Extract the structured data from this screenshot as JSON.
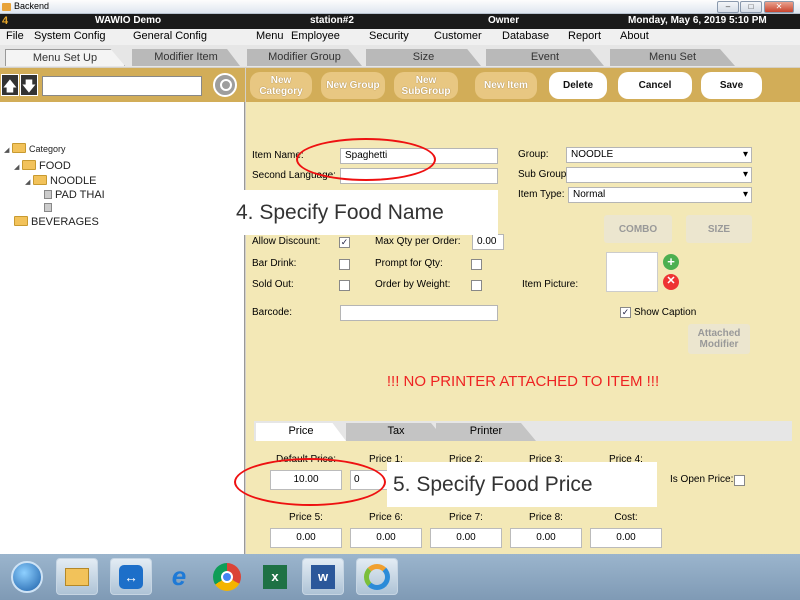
{
  "window": {
    "title": "Backend"
  },
  "appbar": {
    "logo": "4",
    "company": "WAWIO Demo",
    "station": "station#2",
    "user": "Owner",
    "datetime": "Monday, May 6, 2019 5:10 PM"
  },
  "menu": [
    "File",
    "System Config",
    "General Config",
    "Menu",
    "Employee",
    "Security",
    "Customer",
    "Database",
    "Report",
    "About"
  ],
  "tabs": [
    "Menu Set Up",
    "Modifier Item",
    "Modifier Group",
    "Size",
    "Event",
    "Menu Set"
  ],
  "toolbar": {
    "new_category": "New Category",
    "new_group": "New Group",
    "new_subgroup": "New SubGroup",
    "new_item": "New Item",
    "delete": "Delete",
    "cancel": "Cancel",
    "save": "Save"
  },
  "tree": {
    "root": "Category",
    "food": "FOOD",
    "noodle": "NOODLE",
    "pad_thai": "PAD THAI",
    "beverages": "BEVERAGES"
  },
  "form": {
    "item_name_label": "Item Name:",
    "item_name": "Spaghetti",
    "second_language_label": "Second Language:",
    "group_label": "Group:",
    "group_value": "NOODLE",
    "sub_group_label": "Sub Group:",
    "item_type_label": "Item Type:",
    "item_type_value": "Normal",
    "combo": "COMBO",
    "size": "SIZE",
    "allow_discount_label": "Allow Discount:",
    "max_qty_label": "Max Qty per Order:",
    "max_qty_value": "0.00",
    "bar_drink_label": "Bar Drink:",
    "prompt_qty_label": "Prompt for Qty:",
    "sold_out_label": "Sold Out:",
    "order_weight_label": "Order by Weight:",
    "item_picture_label": "Item Picture:",
    "barcode_label": "Barcode:",
    "show_caption_label": "Show Caption",
    "attached_modifier": "Attached Modifier",
    "warning": "!!! NO PRINTER ATTACHED TO ITEM !!!"
  },
  "bottom_tabs": [
    "Price",
    "Tax",
    "Printer"
  ],
  "prices": {
    "default_label": "Default Price:",
    "default_value": "10.00",
    "p1_label": "Price 1:",
    "p1_value": "0",
    "p2_label": "Price 2:",
    "p3_label": "Price 3:",
    "p4_label": "Price 4:",
    "open_price_label": "Is Open Price:",
    "p5_label": "Price 5:",
    "p5_value": "0.00",
    "p6_label": "Price 6:",
    "p6_value": "0.00",
    "p7_label": "Price 7:",
    "p7_value": "0.00",
    "p8_label": "Price 8:",
    "p8_value": "0.00",
    "cost_label": "Cost:",
    "cost_value": "0.00"
  },
  "annotations": {
    "step4": "4. Specify Food Name",
    "step5": "5. Specify Food Price"
  },
  "taskbar": [
    "start-orb",
    "file-explorer",
    "teamviewer",
    "internet-explorer",
    "chrome",
    "excel",
    "word",
    "app"
  ],
  "colors": {
    "accent": "#d2ad58",
    "panel": "#f3e8b6",
    "warning": "#e22222"
  }
}
